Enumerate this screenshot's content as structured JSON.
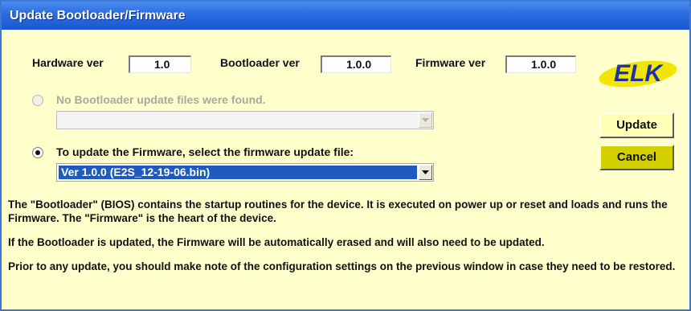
{
  "window": {
    "title": "Update Bootloader/Firmware"
  },
  "versions": {
    "hardware_label": "Hardware ver",
    "hardware_value": "1.0",
    "bootloader_label": "Bootloader ver",
    "bootloader_value": "1.0.0",
    "firmware_label": "Firmware ver",
    "firmware_value": "1.0.0"
  },
  "logo": {
    "text": "ELK",
    "colors": {
      "fill": "#f2e600",
      "text": "#1b2fb0"
    }
  },
  "bootloader_option": {
    "label": "No Bootloader update files were found.",
    "selected": false,
    "enabled": false,
    "combo_value": ""
  },
  "firmware_option": {
    "label": "To update the Firmware, select the firmware update file:",
    "selected": true,
    "enabled": true,
    "combo_value": "Ver 1.0.0 (E2S_12-19-06.bin)"
  },
  "buttons": {
    "update_label": "Update",
    "cancel_label": "Cancel"
  },
  "info": {
    "para1": "The \"Bootloader\" (BIOS) contains the startup routines for the device.  It is executed on power up or reset and loads and runs the Firmware.  The \"Firmware\" is the heart of the device.",
    "para2": "If the Bootloader is updated, the Firmware will be automatically erased and will also need to be updated.",
    "para3": "Prior to any update, you should make note of the configuration settings on the previous window in case they need to be restored."
  },
  "colors": {
    "dialog_bg": "#ffffcc",
    "titlebar": "#2a6ae0",
    "update_button": "#ffffb8",
    "cancel_button": "#d4d000",
    "selection": "#1f5bbf"
  },
  "icons": [
    "radio-off-disabled-icon",
    "radio-on-icon",
    "chevron-down-icon",
    "elk-logo"
  ]
}
